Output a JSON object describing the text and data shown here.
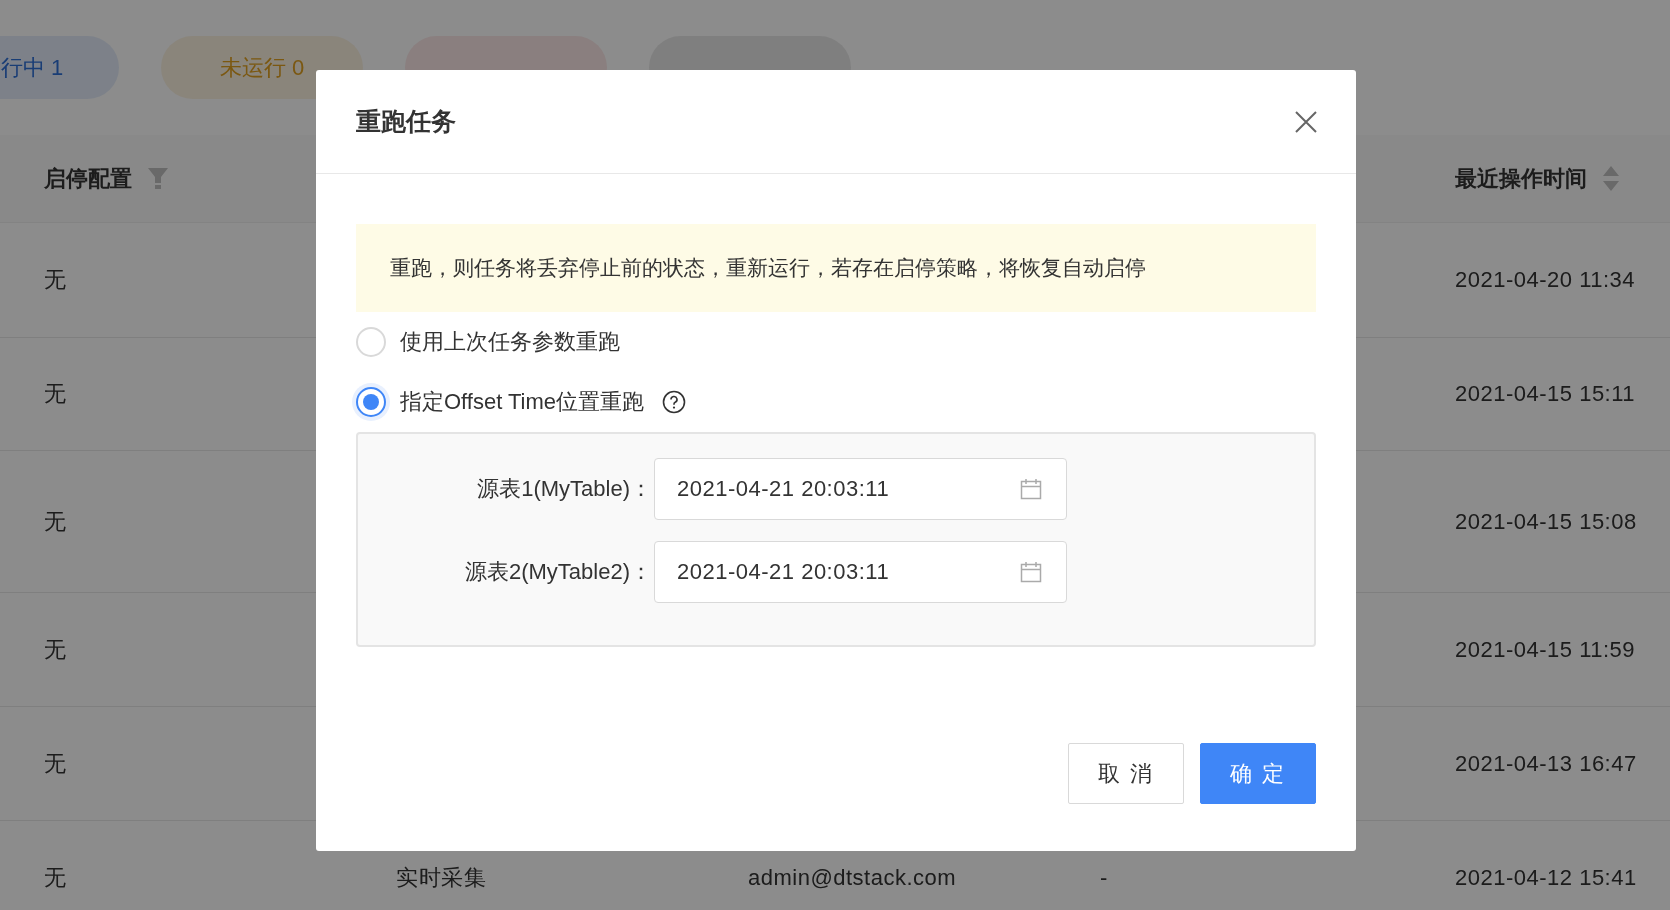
{
  "status_tabs": [
    {
      "label": "行中 1",
      "kind": "running"
    },
    {
      "label": "未运行 0",
      "kind": "pending"
    },
    {
      "kind": "failed"
    },
    {
      "kind": "cancelled"
    }
  ],
  "table": {
    "columns": [
      {
        "label": "启停配置"
      },
      {
        "label": "最近操作时间"
      }
    ],
    "rows": [
      {
        "column_1": "无",
        "column_5": "2021-04-20 11:34"
      },
      {
        "column_1": "无",
        "column_5": "2021-04-15 15:11"
      },
      {
        "column_1": "无",
        "column_5": "2021-04-15 15:08"
      },
      {
        "column_1": "无",
        "column_5": "2021-04-15 11:59"
      },
      {
        "column_1": "无",
        "column_5": "2021-04-13 16:47"
      },
      {
        "column_1": "无",
        "column_2": "实时采集",
        "column_3": "admin@dtstack.com",
        "column_4": "-",
        "column_5": "2021-04-12 15:41"
      }
    ]
  },
  "dialog": {
    "title": "重跑任务",
    "notice": "重跑，则任务将丢弃停止前的状态，重新运行，若存在启停策略，将恢复自动启停",
    "options": [
      {
        "label": "使用上次任务参数重跑",
        "selected": false,
        "help": false
      },
      {
        "label": "指定Offset Time位置重跑",
        "selected": true,
        "help": true
      }
    ],
    "fields": [
      {
        "label": "源表1(MyTable)：",
        "value": "2021-04-21 20:03:11"
      },
      {
        "label": "源表2(MyTable2)：",
        "value": "2021-04-21 20:03:11"
      }
    ],
    "buttons": [
      {
        "label": "取 消",
        "kind": "default"
      },
      {
        "label": "确 定",
        "kind": "primary"
      }
    ]
  }
}
